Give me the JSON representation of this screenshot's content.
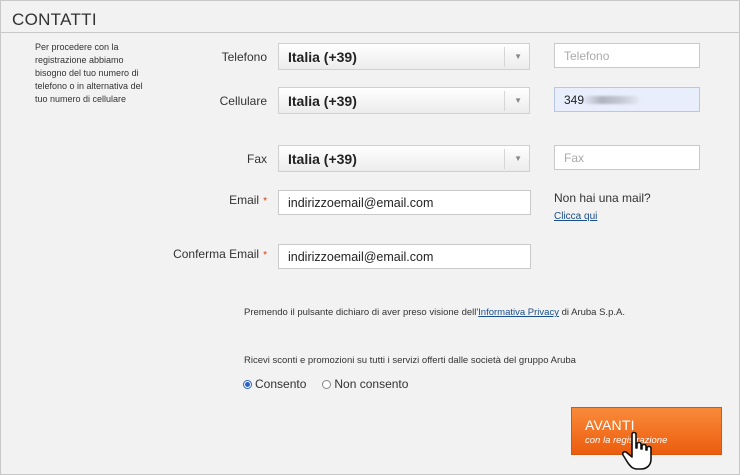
{
  "section": {
    "title": "CONTATTI"
  },
  "intro_text": "Per procedere con la registrazione abbiamo bisogno del tuo numero di telefono o in alternativa del tuo numero di cellulare",
  "fields": {
    "telefono": {
      "label": "Telefono",
      "country": "Italia (+39)",
      "placeholder": "Telefono",
      "value": ""
    },
    "cellulare": {
      "label": "Cellulare",
      "country": "Italia (+39)",
      "placeholder": "",
      "value": "349"
    },
    "fax": {
      "label": "Fax",
      "country": "Italia (+39)",
      "placeholder": "Fax",
      "value": ""
    },
    "email": {
      "label": "Email",
      "required_mark": "*",
      "value": "indirizzoemail@email.com"
    },
    "confirm_email": {
      "label": "Conferma Email",
      "required_mark": "*",
      "value": "indirizzoemail@email.com"
    }
  },
  "no_email": {
    "text": "Non hai una mail?",
    "link": "Clicca qui"
  },
  "privacy": {
    "before": "Premendo il pulsante dichiaro di aver preso visione dell'",
    "link": "Informativa Privacy",
    "after": " di Aruba S.p.A."
  },
  "promo": {
    "text": "Ricevi sconti e promozioni su tutti i servizi offerti dalle società del gruppo Aruba",
    "options": [
      {
        "label": "Consento",
        "selected": true
      },
      {
        "label": "Non consento",
        "selected": false
      }
    ]
  },
  "cta": {
    "label": "AVANTI",
    "sublabel": "con la registrazione"
  },
  "colors": {
    "accent": "#ec5d0e",
    "link": "#1a4f8a",
    "radio": "#2a62c9"
  },
  "icons": {
    "dropdown": "chevron-down-icon",
    "cursor": "hand-pointer-icon"
  }
}
